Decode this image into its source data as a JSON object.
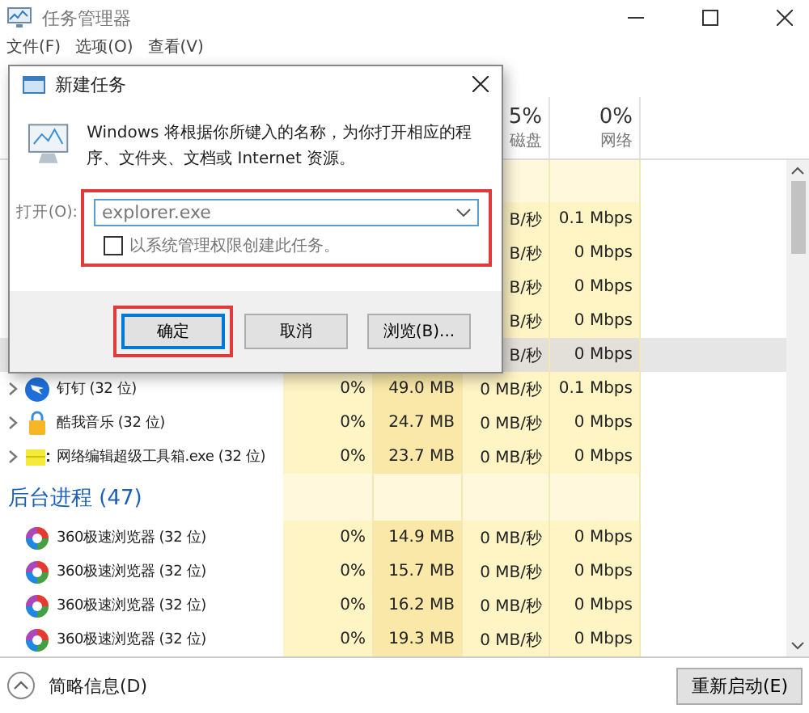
{
  "window": {
    "title": "任务管理器",
    "menu": [
      "文件(F)",
      "选项(O)",
      "查看(V)"
    ]
  },
  "columns": [
    {
      "percent": "5%",
      "label": "磁盘"
    },
    {
      "percent": "0%",
      "label": "网络"
    }
  ],
  "apps": [
    {
      "disk": "B/秒",
      "network": "0.1 Mbps",
      "selected": false
    },
    {
      "disk": "B/秒",
      "network": "0 Mbps",
      "selected": false
    },
    {
      "disk": "B/秒",
      "network": "0 Mbps",
      "selected": false
    },
    {
      "disk": "B/秒",
      "network": "0 Mbps",
      "selected": false
    },
    {
      "disk": "B/秒",
      "network": "0 Mbps",
      "selected": true
    },
    {
      "name": "钉钉 (32 位)",
      "cpu": "0%",
      "memory": "49.0 MB",
      "disk": "0 MB/秒",
      "network": "0.1 Mbps",
      "selected": false,
      "expandable": true
    },
    {
      "name": "酷我音乐 (32 位)",
      "cpu": "0%",
      "memory": "24.7 MB",
      "disk": "0 MB/秒",
      "network": "0 Mbps",
      "selected": false,
      "expandable": true
    },
    {
      "name": "网络编辑超级工具箱.exe (32 位)",
      "cpu": "0%",
      "memory": "23.7 MB",
      "disk": "0 MB/秒",
      "network": "0 Mbps",
      "selected": false,
      "expandable": true
    }
  ],
  "background": {
    "title": "后台进程 (47)",
    "rows": [
      {
        "name": "360极速浏览器 (32 位)",
        "cpu": "0%",
        "memory": "14.9 MB",
        "disk": "0 MB/秒",
        "network": "0 Mbps",
        "selected": false,
        "expandable": false
      },
      {
        "name": "360极速浏览器 (32 位)",
        "cpu": "0%",
        "memory": "15.7 MB",
        "disk": "0 MB/秒",
        "network": "0 Mbps",
        "selected": false,
        "expandable": false
      },
      {
        "name": "360极速浏览器 (32 位)",
        "cpu": "0%",
        "memory": "16.2 MB",
        "disk": "0 MB/秒",
        "network": "0 Mbps",
        "selected": false,
        "expandable": false
      },
      {
        "name": "360极速浏览器 (32 位)",
        "cpu": "0%",
        "memory": "19.3 MB",
        "disk": "0 MB/秒",
        "network": "0 Mbps",
        "selected": false,
        "expandable": false
      }
    ]
  },
  "footer": {
    "details": "简略信息(D)",
    "button": "重新启动(E)"
  },
  "dialog": {
    "title": "新建任务",
    "message": "Windows 将根据你所键入的名称，为你打开相应的程序、文件夹、文档或 Internet 资源。",
    "open_label": "打开(O):",
    "value": "explorer.exe",
    "field_highlighted": true,
    "checkbox": {
      "label": "以系统管理权限创建此任务。",
      "checked": false
    },
    "buttons": [
      {
        "label": "确定",
        "default": true,
        "highlighted": true
      },
      {
        "label": "取消",
        "default": false,
        "highlighted": false
      },
      {
        "label": "浏览(B)...",
        "default": false,
        "highlighted": false
      }
    ]
  }
}
